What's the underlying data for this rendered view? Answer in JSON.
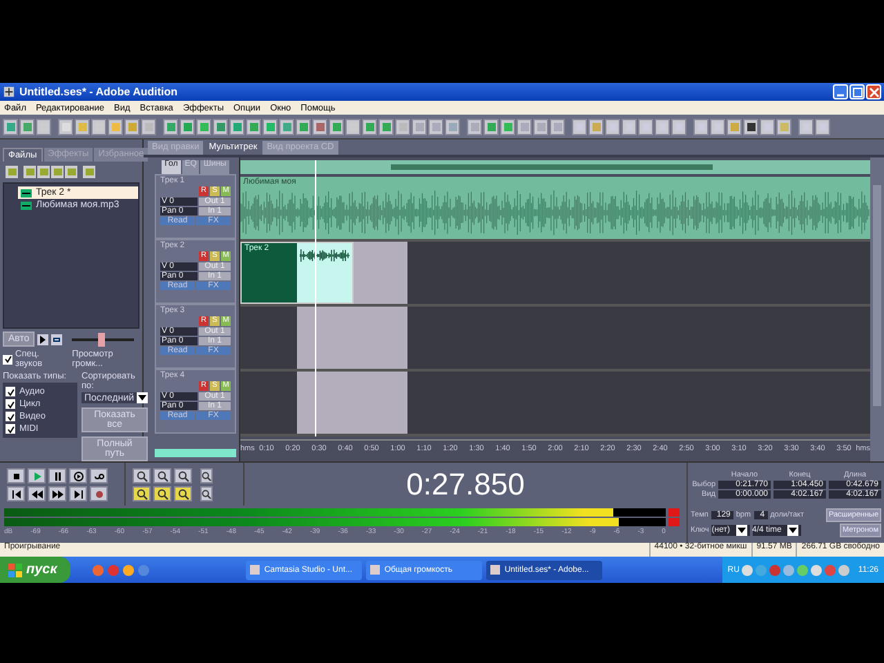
{
  "window": {
    "title": "Untitled.ses* - Adobe Audition"
  },
  "menu": [
    "Файл",
    "Редактирование",
    "Вид",
    "Вставка",
    "Эффекты",
    "Опции",
    "Окно",
    "Помощь"
  ],
  "left_panel": {
    "tabs": [
      {
        "label": "Файлы",
        "selected": true
      },
      {
        "label": "Эффекты",
        "selected": false
      },
      {
        "label": "Избранное",
        "selected": false
      }
    ],
    "files": [
      {
        "name": "Трек 2 *",
        "selected": true
      },
      {
        "name": "Любимая моя.mp3",
        "selected": false
      }
    ],
    "auto_button": "Авто",
    "spectral_checkbox": {
      "label": "Спец. звуков",
      "checked": true
    },
    "volume_label": "Просмотр громк...",
    "volume_slider": {
      "level": 0.45
    },
    "show_types": {
      "title": "Показать типы:",
      "items": [
        {
          "label": "Аудио",
          "checked": true
        },
        {
          "label": "Цикл",
          "checked": true
        },
        {
          "label": "Видео",
          "checked": true
        },
        {
          "label": "MIDI",
          "checked": true
        }
      ]
    },
    "sort": {
      "label": "Сортировать по:",
      "value": "Последний"
    },
    "buttons": [
      "Показать все",
      "Полный путь"
    ]
  },
  "view_tabs": [
    {
      "label": "Вид правки",
      "selected": false
    },
    {
      "label": "Мультитрек",
      "selected": true
    },
    {
      "label": "Вид проекта CD",
      "selected": false
    }
  ],
  "mixer_tabs": [
    {
      "label": "Гол",
      "selected": true
    },
    {
      "label": "EQ",
      "selected": false
    },
    {
      "label": "Шины",
      "selected": false
    }
  ],
  "tracks": [
    {
      "name": "Трек 1",
      "volume": "V 0",
      "pan": "Pan 0",
      "output": "Out 1",
      "input": "In 1",
      "automation": "Read",
      "fx": "FX",
      "record": "R",
      "solo": "S",
      "mute": "M",
      "clip": {
        "name": "Любимая моя"
      }
    },
    {
      "name": "Трек 2",
      "volume": "V 0",
      "pan": "Pan 0",
      "output": "Out 1",
      "input": "In 1",
      "automation": "Read",
      "fx": "FX",
      "record": "R",
      "solo": "S",
      "mute": "M",
      "clip": {
        "name": "Трек 2",
        "selected": true
      }
    },
    {
      "name": "Трек 3",
      "volume": "V 0",
      "pan": "Pan 0",
      "output": "Out 1",
      "input": "In 1",
      "automation": "Read",
      "fx": "FX",
      "record": "R",
      "solo": "S",
      "mute": "M"
    },
    {
      "name": "Трек 4",
      "volume": "V 0",
      "pan": "Pan 0",
      "output": "Out 1",
      "input": "In 1",
      "automation": "Read",
      "fx": "FX",
      "record": "R",
      "solo": "S",
      "mute": "M"
    }
  ],
  "ruler": [
    "hms",
    "0:10",
    "0:20",
    "0:30",
    "0:40",
    "0:50",
    "1:00",
    "1:10",
    "1:20",
    "1:30",
    "1:40",
    "1:50",
    "2:00",
    "2:10",
    "2:20",
    "2:30",
    "2:40",
    "2:50",
    "3:00",
    "3:10",
    "3:20",
    "3:30",
    "3:40",
    "3:50",
    "hms"
  ],
  "time_display": "0:27.850",
  "selection_info": {
    "columns": [
      "Начало",
      "Конец",
      "Длина"
    ],
    "rows": [
      {
        "label": "Выбор",
        "values": [
          "0:21.770",
          "1:04.450",
          "0:42.679"
        ]
      },
      {
        "label": "Вид",
        "values": [
          "0:00.000",
          "4:02.167",
          "4:02.167"
        ]
      }
    ]
  },
  "meter": {
    "channels": [
      {
        "level": 0.92,
        "clipped": true
      },
      {
        "level": 0.93,
        "clipped": true
      }
    ],
    "scale": [
      "dB",
      "-69",
      "-66",
      "-63",
      "-60",
      "-57",
      "-54",
      "-51",
      "-48",
      "-45",
      "-42",
      "-39",
      "-36",
      "-33",
      "-30",
      "-27",
      "-24",
      "-21",
      "-18",
      "-15",
      "-12",
      "-9",
      "-6",
      "-3",
      "0"
    ]
  },
  "tempo": {
    "tempo_label": "Темп",
    "tempo": "129",
    "bpm_label": "bpm",
    "beats": "4",
    "beats_label": "доли/такт",
    "advanced_button": "Расширенные",
    "key_label": "Ключ",
    "key": "(нет)",
    "time_signature": "4/4 time",
    "metronome_button": "Метроном"
  },
  "status_bar": {
    "state": "Проигрывание",
    "format": "44100 • 32-битное микш",
    "memory": "91.57 MB",
    "disk": "266.71 GB свободно"
  },
  "taskbar": {
    "start": "пуск",
    "tasks": [
      {
        "label": "Camtasia Studio - Unt...",
        "selected": false
      },
      {
        "label": "Общая громкость",
        "selected": false
      },
      {
        "label": "Untitled.ses* - Adobe...",
        "selected": true
      }
    ],
    "language": "RU",
    "clock": "11:26"
  }
}
